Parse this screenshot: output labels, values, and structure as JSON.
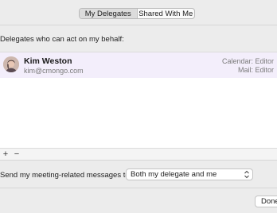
{
  "tabs": [
    {
      "label": "My Delegates",
      "active": true
    },
    {
      "label": "Shared With Me",
      "active": false
    }
  ],
  "heading": "Delegates who can act on my behalf:",
  "delegates": [
    {
      "name": "Kim Weston",
      "email": "kim@cmongo.com",
      "permissions": [
        "Calendar: Editor",
        "Mail: Editor"
      ]
    }
  ],
  "list_controls": {
    "add_label": "+",
    "remove_label": "−"
  },
  "meeting_messages": {
    "label": "Send my meeting-related messages to:",
    "selected": "Both my delegate and me"
  },
  "done_label": "Done",
  "colors": {
    "window_bg": "#ececec",
    "row_highlight": "#f3eefb",
    "secondary_text": "#7a7a7a"
  }
}
